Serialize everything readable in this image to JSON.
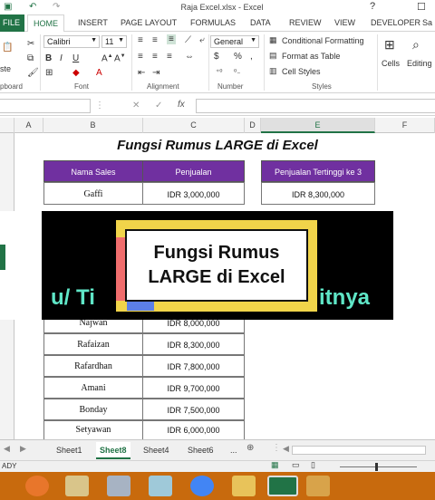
{
  "window": {
    "title": "Raja Excel.xlsx - Excel",
    "help": "?",
    "minimize": "—",
    "restore": "☐",
    "close": "✕"
  },
  "ribbon_tabs": [
    {
      "label": "FILE"
    },
    {
      "label": "HOME"
    },
    {
      "label": "INSERT"
    },
    {
      "label": "PAGE LAYOUT"
    },
    {
      "label": "FORMULAS"
    },
    {
      "label": "DATA"
    },
    {
      "label": "REVIEW"
    },
    {
      "label": "VIEW"
    },
    {
      "label": "DEVELOPER"
    },
    {
      "label": "Sa"
    }
  ],
  "ribbon": {
    "font_name": "Calibri",
    "font_size": "11",
    "number_format": "General",
    "conditional_formatting": "Conditional Formatting",
    "format_as_table": "Format as Table",
    "cell_styles": "Cell Styles",
    "cells": "Cells",
    "editing": "Editing",
    "paste_fragment": "ste",
    "groups": {
      "clipboard": "pboard",
      "font": "Font",
      "alignment": "Alignment",
      "number": "Number",
      "styles": "Styles"
    }
  },
  "formula_bar": {
    "cancel": "✕",
    "enter": "✓",
    "fx": "fx",
    "value": ""
  },
  "columns": [
    "A",
    "B",
    "C",
    "D",
    "E",
    "F"
  ],
  "sheet": {
    "title": "Fungsi Rumus LARGE di Excel",
    "headers": {
      "name": "Nama Sales",
      "sales": "Penjualan"
    },
    "rows": [
      {
        "name": "Gaffi",
        "sales": "IDR 3,000,000"
      },
      {
        "name": "Najwan",
        "sales": "IDR 8,000,000"
      },
      {
        "name": "Rafaizan",
        "sales": "IDR 8,300,000"
      },
      {
        "name": "Rafardhan",
        "sales": "IDR 7,800,000"
      },
      {
        "name": "Amani",
        "sales": "IDR 9,700,000"
      },
      {
        "name": "Bonday",
        "sales": "IDR 7,500,000"
      },
      {
        "name": "Setyawan",
        "sales": "IDR 6,000,000"
      }
    ],
    "result": {
      "header": "Penjualan Tertinggi ke 3",
      "value": "IDR 8,300,000"
    }
  },
  "overlay": {
    "left_text": "u/ Ti",
    "right_text": "itnya",
    "frame_line1": "Fungsi Rumus",
    "frame_line2": "LARGE di Excel"
  },
  "sheet_tabs": [
    {
      "label": "Sheet1"
    },
    {
      "label": "Sheet8"
    },
    {
      "label": "Sheet4"
    },
    {
      "label": "Sheet6"
    },
    {
      "label": "..."
    }
  ],
  "status": {
    "ready": "ADY"
  },
  "colors": {
    "excel_green": "#217346",
    "header_purple": "#7030a0",
    "overlay_teal": "#5fe6c7",
    "frame_yellow": "#f1d44a",
    "taskbar_orange": "#c86a0d"
  }
}
